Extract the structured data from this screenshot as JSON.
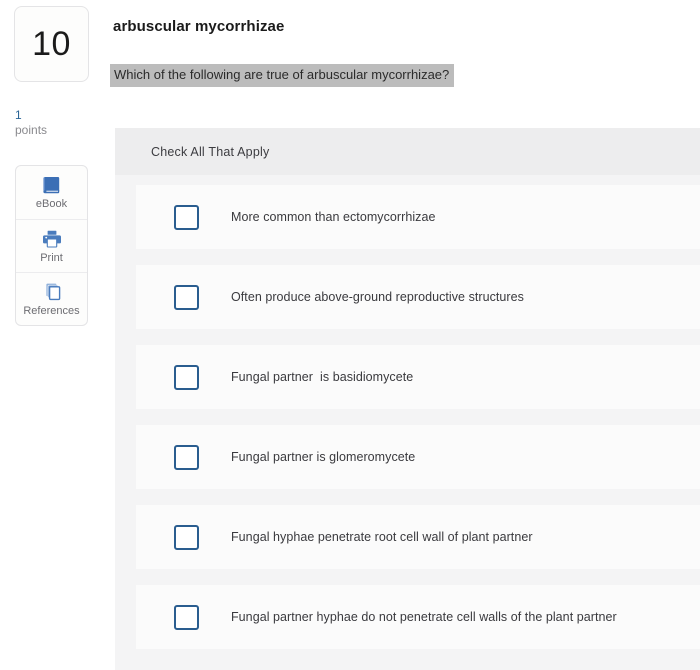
{
  "question": {
    "number": "10",
    "points_value": "1",
    "points_label": "points",
    "title": "arbuscular mycorrhizae",
    "prompt": "Which of the following are true of arbuscular mycorrhizae?"
  },
  "tools": [
    {
      "label": "eBook",
      "icon": "ebook-icon"
    },
    {
      "label": "Print",
      "icon": "print-icon"
    },
    {
      "label": "References",
      "icon": "references-icon"
    }
  ],
  "answer_panel": {
    "header": "Check All That Apply",
    "options": [
      {
        "label": "More common than ectomycorrhizae",
        "checked": false
      },
      {
        "label": "Often produce above-ground reproductive structures",
        "checked": false
      },
      {
        "label": "Fungal partner  is basidiomycete",
        "checked": false
      },
      {
        "label": "Fungal partner is glomeromycete",
        "checked": false
      },
      {
        "label": "Fungal hyphae penetrate root cell wall of plant partner",
        "checked": false
      },
      {
        "label": "Fungal partner hyphae do not penetrate cell walls of the plant partner",
        "checked": false
      }
    ]
  },
  "colors": {
    "accent_blue": "#2a5d8f",
    "points_blue": "#2a6496",
    "highlight_gray": "#bcbcbc",
    "panel_bg": "#f4f4f5",
    "panel_header_bg": "#ededee",
    "option_bg": "#fbfbfb"
  }
}
